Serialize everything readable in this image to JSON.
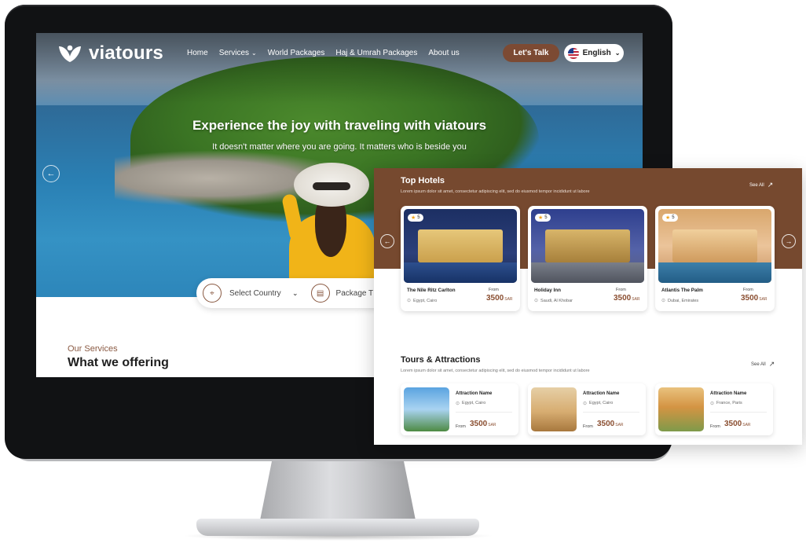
{
  "brand": {
    "name": "viatours"
  },
  "nav": {
    "items": [
      {
        "label": "Home"
      },
      {
        "label": "Services",
        "has_dropdown": true
      },
      {
        "label": "World Packages"
      },
      {
        "label": "Haj & Umrah Packages"
      },
      {
        "label": "About us"
      }
    ],
    "cta_label": "Let's Talk",
    "language": "English"
  },
  "hero": {
    "headline": "Experience the joy with traveling with viatours",
    "subline": "It doesn't matter where you are going. It matters who is beside you"
  },
  "search": {
    "country_placeholder": "Select Country",
    "package_placeholder": "Package T"
  },
  "services": {
    "eyebrow": "Our Services",
    "title": "What we offering"
  },
  "top_hotels": {
    "title": "Top Hotels",
    "subtitle": "Lorem ipsum dolor sit amet, consectetur adipiscing elit, sed do eiusmod tempor incididunt ut labore",
    "see_all": "See All",
    "items": [
      {
        "rating": "5",
        "name": "The Nile Ritz Carlton",
        "location": "Egypt, Cairo",
        "from": "From",
        "price": "3500",
        "currency": "SAR"
      },
      {
        "rating": "5",
        "name": "Holiday Inn",
        "location": "Saudi, Al Khobar",
        "from": "From",
        "price": "3500",
        "currency": "SAR"
      },
      {
        "rating": "5",
        "name": "Atlantis The Palm",
        "location": "Dubai, Emirates",
        "from": "From",
        "price": "3500",
        "currency": "SAR"
      }
    ]
  },
  "tours": {
    "title": "Tours & Attractions",
    "subtitle": "Lorem ipsum dolor sit amet, consectetur adipiscing elit, sed do eiusmod tempor incididunt ut labore",
    "see_all": "See All",
    "items": [
      {
        "name": "Attraction Name",
        "location": "Egypt, Cairo",
        "from": "From",
        "price": "3500",
        "currency": "SAR"
      },
      {
        "name": "Attraction Name",
        "location": "Egypt, Cairo",
        "from": "From",
        "price": "3500",
        "currency": "SAR"
      },
      {
        "name": "Attraction Name",
        "location": "France, Paris",
        "from": "From",
        "price": "3500",
        "currency": "SAR"
      }
    ]
  },
  "colors": {
    "brand_brown": "#76492f",
    "accent_brown": "#8a4e30",
    "star": "#f2a41e"
  },
  "icons": {
    "rating": "star-icon",
    "location": "location-pin-icon",
    "see_all": "arrow-up-right-icon",
    "carousel_prev": "arrow-left-icon",
    "carousel_next": "arrow-right-icon",
    "country": "map-pin-icon",
    "package": "package-icon",
    "dropdown": "chevron-down-icon",
    "language_flag": "us-flag-icon"
  }
}
